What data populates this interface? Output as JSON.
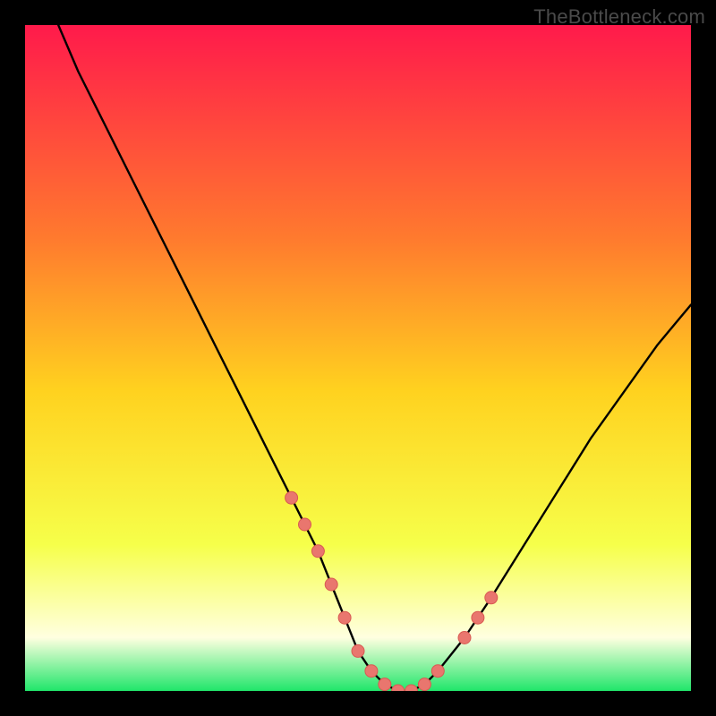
{
  "watermark": "TheBottleneck.com",
  "colors": {
    "grad_top": "#ff1a4b",
    "grad_mid_upper": "#ff7a2e",
    "grad_mid": "#ffd21f",
    "grad_lower": "#f6ff4a",
    "grad_pale": "#ffffe0",
    "grad_bottom": "#20e66a",
    "curve": "#000000",
    "marker_fill": "#e9766e",
    "marker_stroke": "#d95a52",
    "frame": "#000000"
  },
  "chart_data": {
    "type": "line",
    "title": "",
    "xlabel": "",
    "ylabel": "",
    "xlim": [
      0,
      100
    ],
    "ylim": [
      0,
      100
    ],
    "series": [
      {
        "name": "bottleneck-curve",
        "x": [
          5,
          8,
          12,
          16,
          20,
          24,
          28,
          32,
          36,
          40,
          42,
          44,
          46,
          48,
          50,
          52,
          54,
          56,
          58,
          60,
          62,
          66,
          70,
          75,
          80,
          85,
          90,
          95,
          100
        ],
        "y": [
          100,
          93,
          85,
          77,
          69,
          61,
          53,
          45,
          37,
          29,
          25,
          21,
          16,
          11,
          6,
          3,
          1,
          0,
          0,
          1,
          3,
          8,
          14,
          22,
          30,
          38,
          45,
          52,
          58
        ]
      }
    ],
    "markers": {
      "name": "highlighted-points",
      "x": [
        40,
        42,
        44,
        46,
        48,
        50,
        52,
        54,
        56,
        58,
        60,
        62,
        66,
        68,
        70
      ],
      "y": [
        29,
        25,
        21,
        16,
        11,
        6,
        3,
        1,
        0,
        0,
        1,
        3,
        8,
        11,
        14
      ]
    }
  }
}
